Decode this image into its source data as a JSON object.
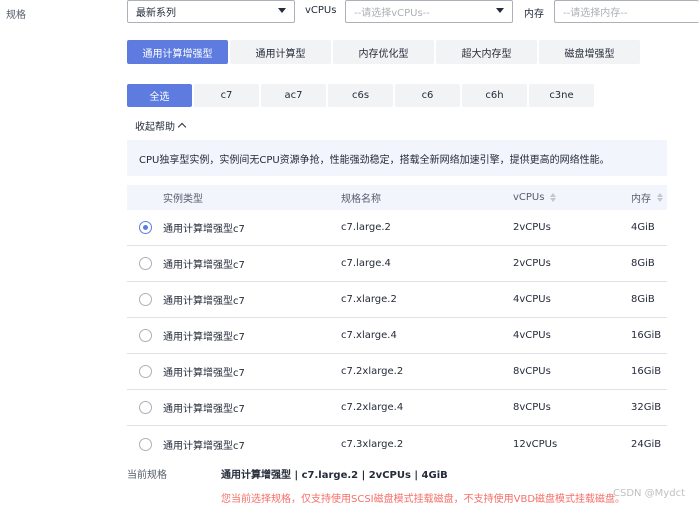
{
  "spec_label": "规格",
  "filters": {
    "series_value": "最新系列",
    "vcpu_label": "vCPUs",
    "vcpu_placeholder": "--请选择vCPUs--",
    "mem_label": "内存",
    "mem_placeholder": "--请选择内存--"
  },
  "tabs": [
    {
      "label": "通用计算增强型",
      "active": true
    },
    {
      "label": "通用计算型",
      "active": false
    },
    {
      "label": "内存优化型",
      "active": false
    },
    {
      "label": "超大内存型",
      "active": false
    },
    {
      "label": "磁盘增强型",
      "active": false
    }
  ],
  "chips": [
    {
      "label": "全选",
      "active": true
    },
    {
      "label": "c7",
      "active": false
    },
    {
      "label": "ac7",
      "active": false
    },
    {
      "label": "c6s",
      "active": false
    },
    {
      "label": "c6",
      "active": false
    },
    {
      "label": "c6h",
      "active": false
    },
    {
      "label": "c3ne",
      "active": false
    }
  ],
  "help": {
    "toggle_label": "收起帮助",
    "text": "CPU独享型实例，实例间无CPU资源争抢，性能强劲稳定，搭载全新网络加速引擎，提供更高的网络性能。"
  },
  "table": {
    "headers": {
      "type": "实例类型",
      "name": "规格名称",
      "vcpu": "vCPUs",
      "mem": "内存"
    },
    "rows": [
      {
        "type": "通用计算增强型c7",
        "name": "c7.large.2",
        "vcpu": "2vCPUs",
        "mem": "4GiB",
        "selected": true
      },
      {
        "type": "通用计算增强型c7",
        "name": "c7.large.4",
        "vcpu": "2vCPUs",
        "mem": "8GiB",
        "selected": false
      },
      {
        "type": "通用计算增强型c7",
        "name": "c7.xlarge.2",
        "vcpu": "4vCPUs",
        "mem": "8GiB",
        "selected": false
      },
      {
        "type": "通用计算增强型c7",
        "name": "c7.xlarge.4",
        "vcpu": "4vCPUs",
        "mem": "16GiB",
        "selected": false
      },
      {
        "type": "通用计算增强型c7",
        "name": "c7.2xlarge.2",
        "vcpu": "8vCPUs",
        "mem": "16GiB",
        "selected": false
      },
      {
        "type": "通用计算增强型c7",
        "name": "c7.2xlarge.4",
        "vcpu": "8vCPUs",
        "mem": "32GiB",
        "selected": false
      },
      {
        "type": "通用计算增强型c7",
        "name": "c7.3xlarge.2",
        "vcpu": "12vCPUs",
        "mem": "24GiB",
        "selected": false
      }
    ]
  },
  "current": {
    "label": "当前规格",
    "value": "通用计算增强型 | c7.large.2 | 2vCPUs | 4GiB"
  },
  "warning": "您当前选择规格，仅支持使用SCSI磁盘模式挂载磁盘，不支持使用VBD磁盘模式挂载磁盘。",
  "watermark": "CSDN @Mydct",
  "colors": {
    "accent": "#5e7ce0",
    "warning": "#f66f6a",
    "help_bg": "#f2f5fc"
  }
}
